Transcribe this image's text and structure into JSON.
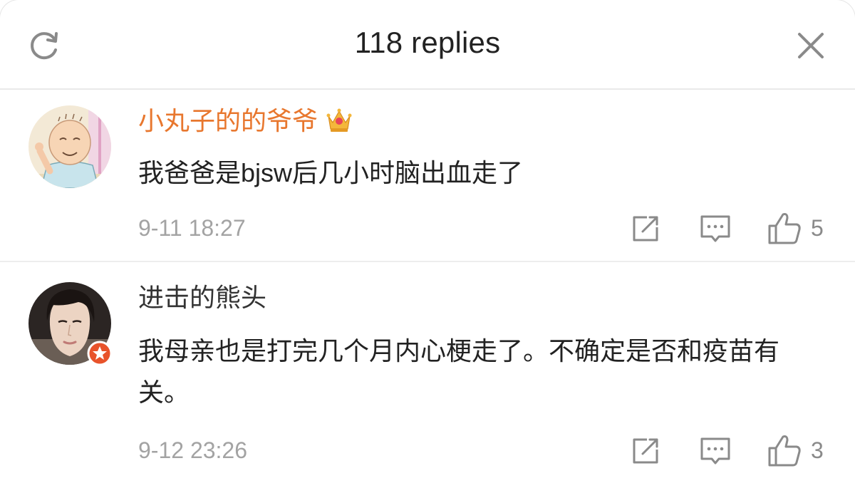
{
  "header": {
    "title": "118 replies"
  },
  "comments": [
    {
      "username": "小丸子的的爷爷",
      "text": "我爸爸是bjsw后几小时脑出血走了",
      "time": "9-11 18:27",
      "likes": "5"
    },
    {
      "username": "进击的熊头",
      "text": "我母亲也是打完几个月内心梗走了。不确定是否和疫苗有关。",
      "time": "9-12 23:26",
      "likes": "3"
    }
  ],
  "colors": {
    "vip_name": "#e8772e",
    "badge": "#e8532b",
    "icon": "#8a8a8a"
  }
}
